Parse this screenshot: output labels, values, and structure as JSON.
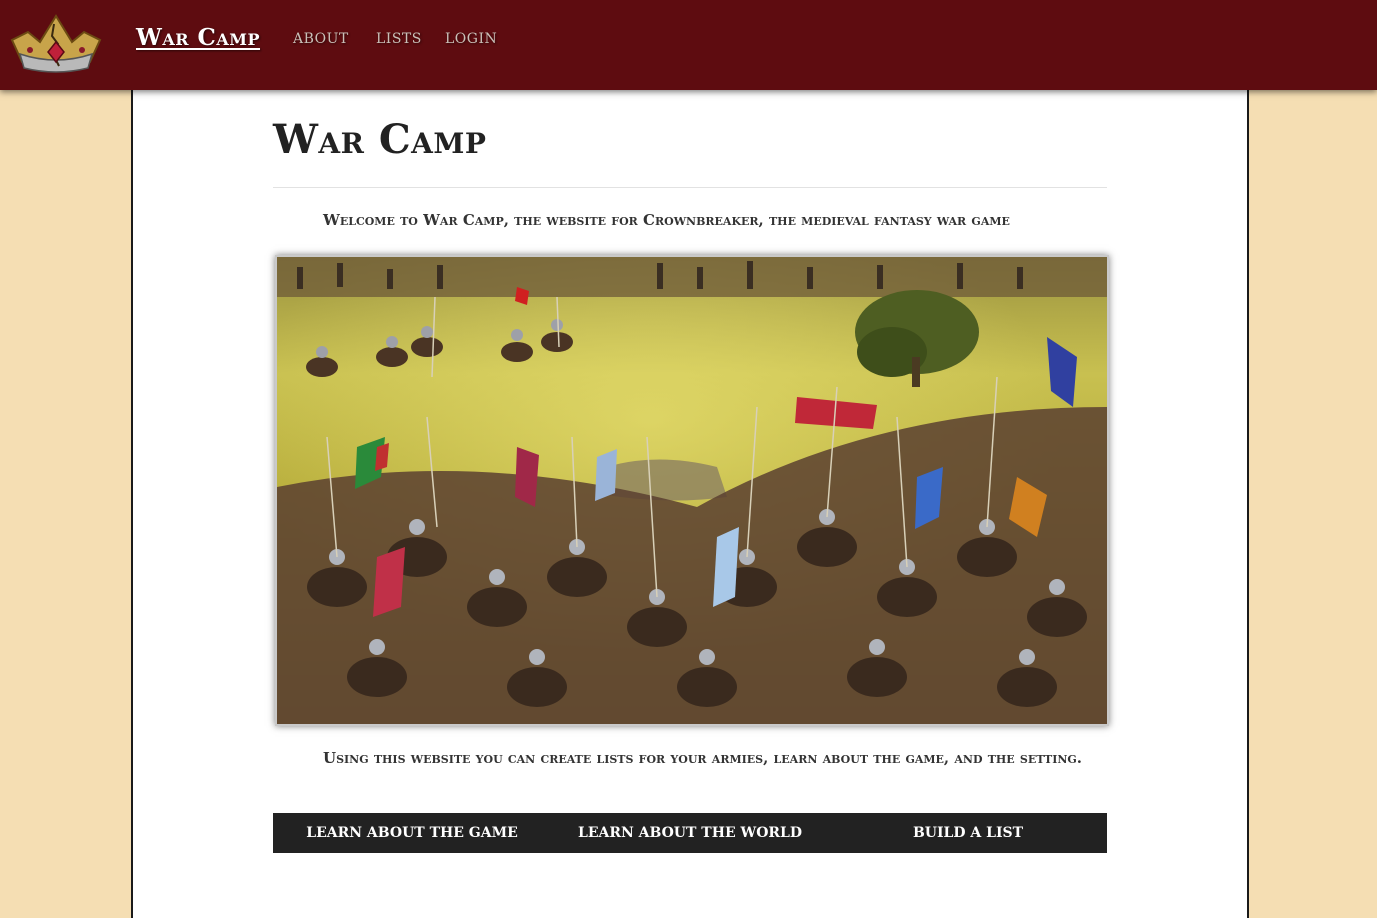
{
  "navbar": {
    "brand": "War Camp",
    "links": [
      "ABOUT",
      "LISTS",
      "LOGIN"
    ],
    "logo_icon": "crown-icon",
    "background_color": "#5e0c10"
  },
  "page": {
    "background_color": "#f5deb3",
    "title": "War Camp",
    "welcome": "Welcome to War Camp, the website for Crownbreaker, the medieval fantasy war game",
    "intro": "Using this website you can create lists for your armies, learn about the game, and the setting."
  },
  "buttons": [
    "LEARN ABOUT THE GAME",
    "LEARN ABOUT THE WORLD",
    "BUILD A LIST"
  ]
}
